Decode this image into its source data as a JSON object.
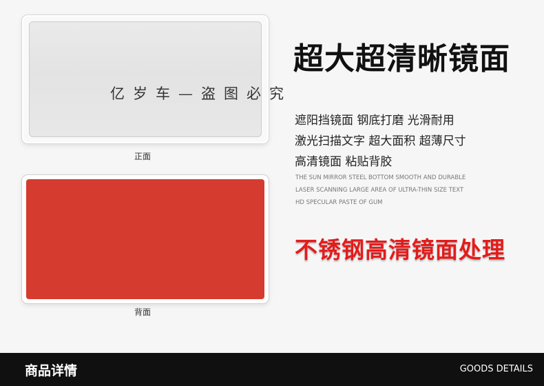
{
  "watermark": "亿岁车—盗图必究",
  "images": {
    "front_caption": "正面",
    "back_caption": "背面",
    "front_color": "#e6e6e6",
    "back_color": "#d63b30"
  },
  "headline": "超大超清晰镜面",
  "features_cn": [
    "遮阳挡镜面  钢底打磨  光滑耐用",
    "激光扫描文字  超大面积  超薄尺寸",
    "高清镜面  粘贴背胶"
  ],
  "features_en": [
    "THE SUN MIRROR STEEL BOTTOM SMOOTH AND DURABLE",
    "LASER SCANNING LARGE AREA OF ULTRA-THIN SIZE TEXT",
    "HD SPECULAR PASTE OF GUM"
  ],
  "red_headline": "不锈钢高清镜面处理",
  "red_headline_color": "#e41b1b",
  "footer": {
    "title": "商品详情",
    "english": "GOODS DETAILS"
  }
}
